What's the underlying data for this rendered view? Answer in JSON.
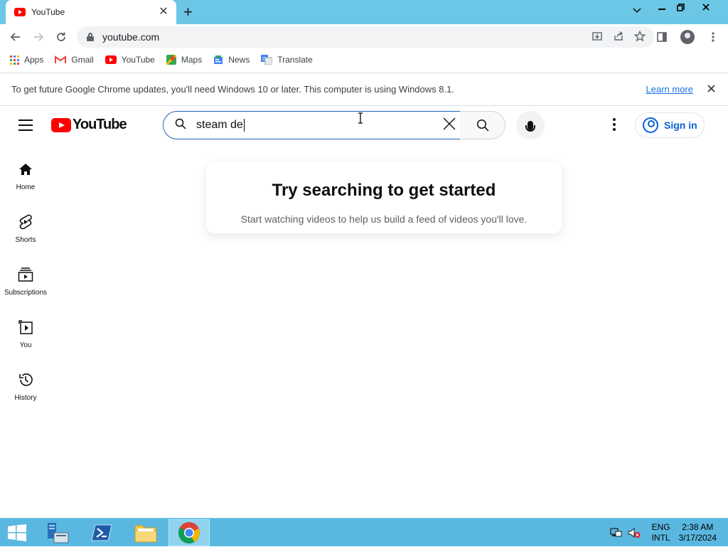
{
  "browser": {
    "tab_title": "YouTube",
    "url": "youtube.com",
    "bookmarks": [
      {
        "label": "Apps"
      },
      {
        "label": "Gmail"
      },
      {
        "label": "YouTube"
      },
      {
        "label": "Maps"
      },
      {
        "label": "News"
      },
      {
        "label": "Translate"
      }
    ],
    "infobar": {
      "message": "To get future Google Chrome updates, you'll need Windows 10 or later. This computer is using Windows 8.1.",
      "link": "Learn more"
    }
  },
  "youtube": {
    "logo_text": "YouTube",
    "search_value": "steam de",
    "sign_in": "Sign in",
    "guide": [
      {
        "label": "Home",
        "icon": "home-icon"
      },
      {
        "label": "Shorts",
        "icon": "shorts-icon"
      },
      {
        "label": "Subscriptions",
        "icon": "subscriptions-icon"
      },
      {
        "label": "You",
        "icon": "you-icon"
      },
      {
        "label": "History",
        "icon": "history-icon"
      }
    ],
    "empty_state": {
      "title": "Try searching to get started",
      "subtitle": "Start watching videos to help us build a feed of videos you'll love."
    }
  },
  "taskbar": {
    "lang_top": "ENG",
    "lang_bottom": "INTL",
    "time": "2:38 AM",
    "date": "3/17/2024"
  },
  "colors": {
    "titlebar": "#6cc6e6",
    "youtube_red": "#ff0000",
    "link_blue": "#065fd4",
    "taskbar": "#5ab8e0"
  }
}
